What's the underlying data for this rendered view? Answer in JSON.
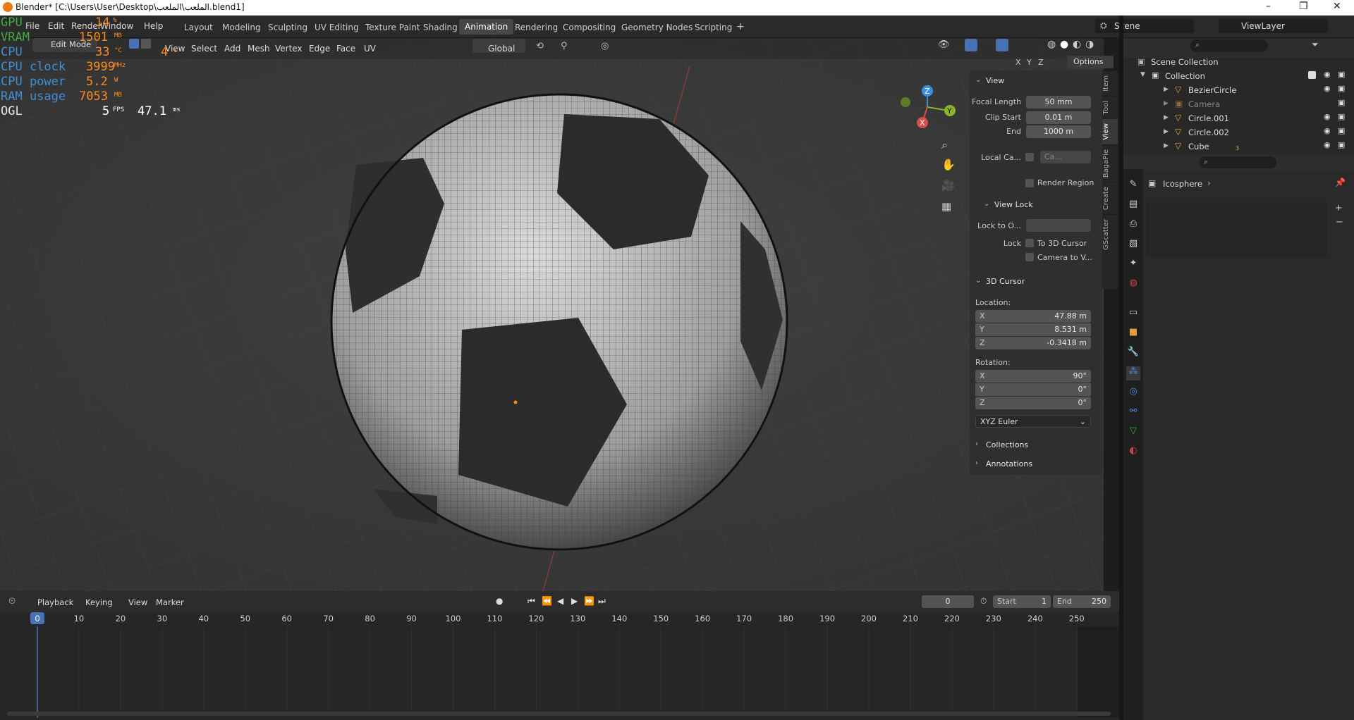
{
  "window": {
    "title": "Blender* [C:\\Users\\User\\Desktop\\الملعب\\الملعب.blend1]",
    "minimize": "–",
    "maximize": "❐",
    "close": "✕"
  },
  "menu": [
    "File",
    "Edit",
    "Render",
    "Window",
    "Help"
  ],
  "workspaces": [
    "Layout",
    "Modeling",
    "Sculpting",
    "UV Editing",
    "Texture Paint",
    "Shading",
    "Animation",
    "Rendering",
    "Compositing",
    "Geometry Nodes",
    "Scripting",
    "+"
  ],
  "scene": {
    "label": "Scene",
    "viewlayer": "ViewLayer"
  },
  "viewport_header": {
    "mode": "Edit Mode",
    "menus": [
      "View",
      "Select",
      "Add",
      "Mesh",
      "Vertex",
      "Edge",
      "Face",
      "UV"
    ],
    "orientation": "Global",
    "axes": [
      "X",
      "Y",
      "Z"
    ],
    "options": "Options"
  },
  "overlay": [
    {
      "key": "GPU",
      "val": "14",
      "unit": "%"
    },
    {
      "key": "VRAM",
      "val": "1501",
      "unit": "MB"
    },
    {
      "key": "CPU",
      "val": "33",
      "unit": "°C"
    },
    {
      "key": "CPU clock",
      "val": "3999",
      "unit": "MHz"
    },
    {
      "key": "CPU power",
      "val": "5.2",
      "unit": "W"
    },
    {
      "key": "RAM usage",
      "val": "7053",
      "unit": "MB"
    },
    {
      "key": "OGL",
      "val": "5",
      "unit": "FPS"
    }
  ],
  "overlay_extra": {
    "cpu_usage": "4",
    "cpu_usage_unit": "%",
    "frametime": "47.1",
    "frametime_unit": "ms"
  },
  "gizmo": {
    "x": "X",
    "y": "Y",
    "z": "Z"
  },
  "npanel": {
    "tabs": [
      "Item",
      "Tool",
      "View",
      "BagaPie",
      "Create",
      "GScatter"
    ],
    "view_title": "View",
    "focal_label": "Focal Length",
    "focal": "50 mm",
    "clip_start_label": "Clip Start",
    "clip_start": "0.01 m",
    "end_label": "End",
    "end": "1000 m",
    "local_cam_label": "Local Ca...",
    "local_cam": "Ca...",
    "render_region": "Render Region",
    "view_lock_title": "View Lock",
    "lock_to_label": "Lock to O...",
    "lock_label": "Lock",
    "to_cursor": "To 3D Cursor",
    "camera_to_view": "Camera to V...",
    "cursor_title": "3D Cursor",
    "location_label": "Location:",
    "loc": [
      {
        "a": "X",
        "v": "47.88 m"
      },
      {
        "a": "Y",
        "v": "8.531 m"
      },
      {
        "a": "Z",
        "v": "-0.3418 m"
      }
    ],
    "rotation_label": "Rotation:",
    "rot": [
      {
        "a": "X",
        "v": "90°"
      },
      {
        "a": "Y",
        "v": "0°"
      },
      {
        "a": "Z",
        "v": "0°"
      }
    ],
    "rot_mode": "XYZ Euler",
    "collections": "Collections",
    "annotations": "Annotations"
  },
  "outliner": {
    "root": "Scene Collection",
    "collection": "Collection",
    "items": [
      "BezierCircle",
      "Camera",
      "Circle.001",
      "Circle.002",
      "Cube"
    ],
    "cube_badge": "3"
  },
  "properties": {
    "object": "Icosphere"
  },
  "timeline": {
    "menus": [
      "Playback",
      "Keying",
      "View",
      "Marker"
    ],
    "current_frame": "0",
    "start_label": "Start",
    "start": "1",
    "end_label": "End",
    "end": "250",
    "ticks": [
      "0",
      "10",
      "20",
      "30",
      "40",
      "50",
      "60",
      "70",
      "80",
      "90",
      "100",
      "110",
      "120",
      "130",
      "140",
      "150",
      "160",
      "170",
      "180",
      "190",
      "200",
      "210",
      "220",
      "230",
      "240",
      "250"
    ]
  },
  "colors": {
    "accent": "#4772b3",
    "active_ws": "#474747",
    "orange": "#e0a040"
  }
}
